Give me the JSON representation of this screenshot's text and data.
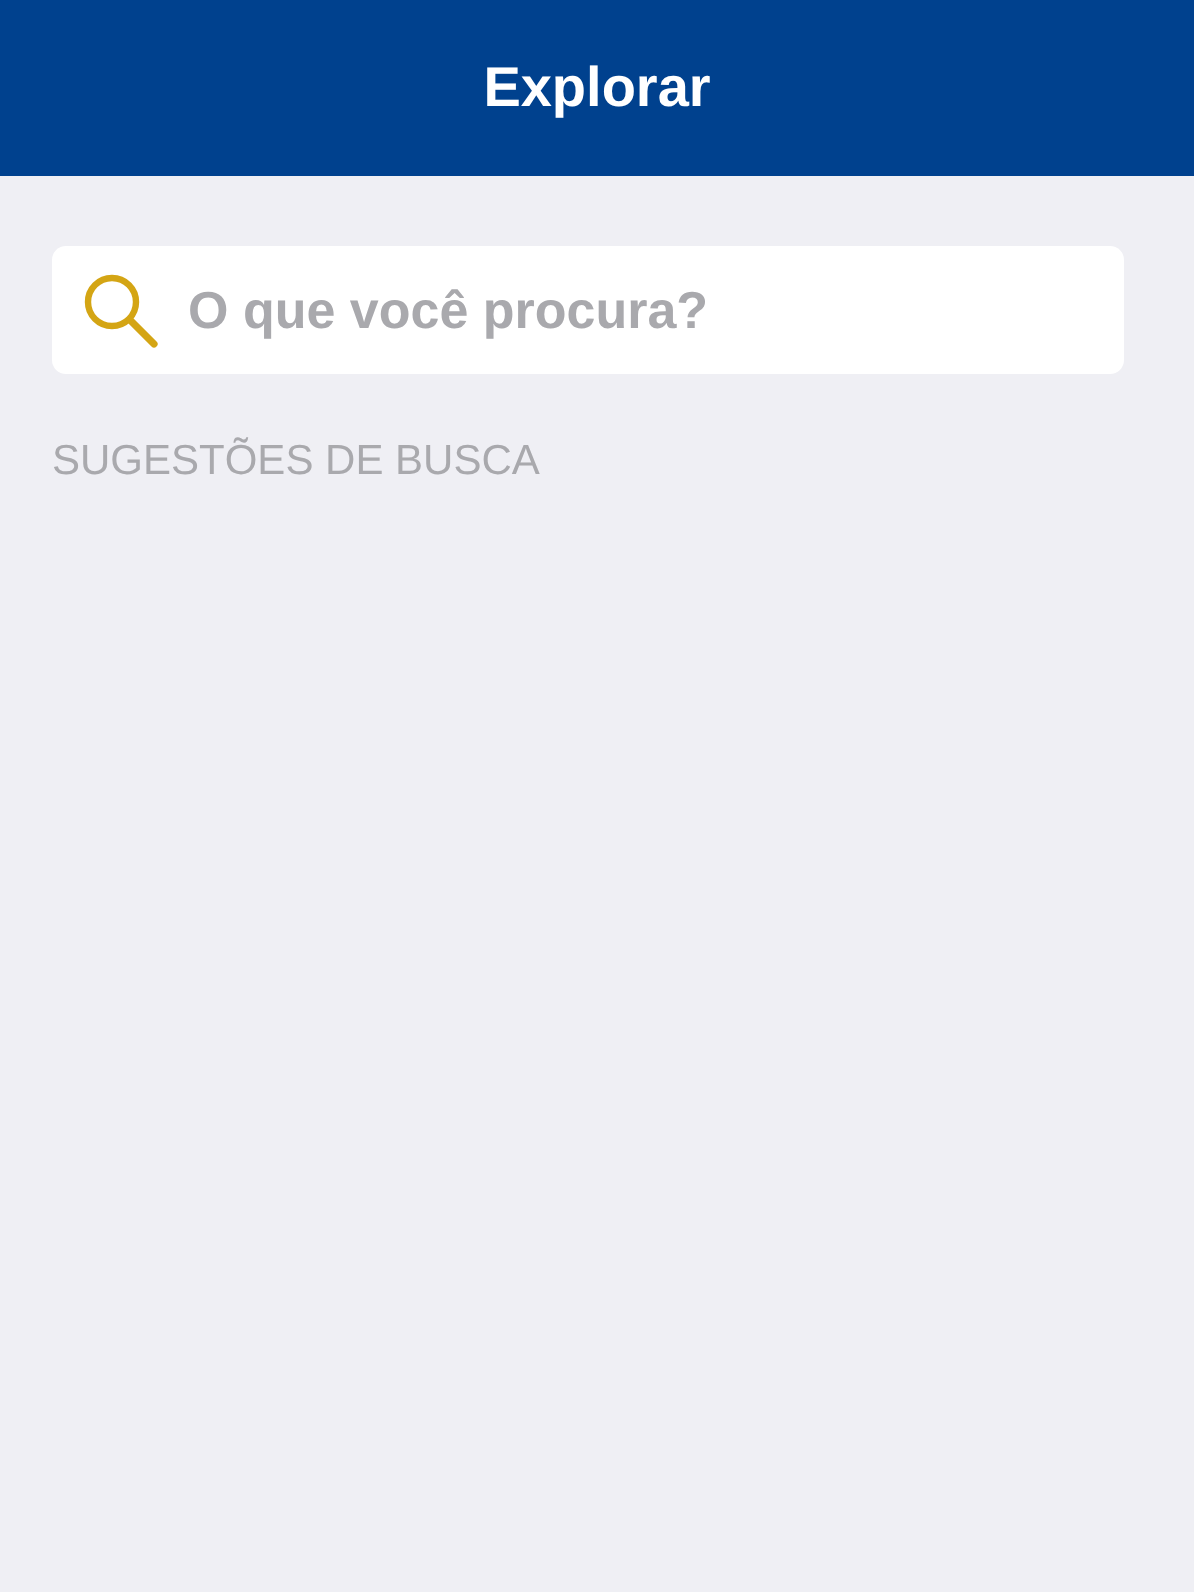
{
  "header": {
    "title": "Explorar"
  },
  "search": {
    "placeholder": "O que você procura?"
  },
  "suggestions": {
    "heading": "SUGESTÕES DE BUSCA"
  }
}
